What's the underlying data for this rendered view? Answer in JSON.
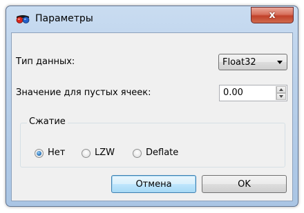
{
  "window": {
    "title": "Параметры",
    "close_label": "x"
  },
  "form": {
    "data_type_label": "Тип данных:",
    "data_type_value": "Float32",
    "empty_value_label": "Значение для пустых ячеек:",
    "empty_value_value": "0.00"
  },
  "compression": {
    "title": "Сжатие",
    "options": [
      {
        "label": "Нет",
        "checked": true
      },
      {
        "label": "LZW",
        "checked": false
      },
      {
        "label": "Deflate",
        "checked": false
      }
    ]
  },
  "buttons": {
    "cancel_label": "Отмена",
    "ok_label": "OK"
  },
  "colors": {
    "title_bar": "#b9d0ea",
    "close_button": "#c1412a",
    "radio_checked": "#2b77bd",
    "default_button_border": "#3c7fb1"
  },
  "icons": {
    "app": "glasses-icon",
    "close": "close-icon",
    "dropdown": "chevron-down-icon",
    "spin_up": "arrow-up-icon",
    "spin_down": "arrow-down-icon"
  }
}
